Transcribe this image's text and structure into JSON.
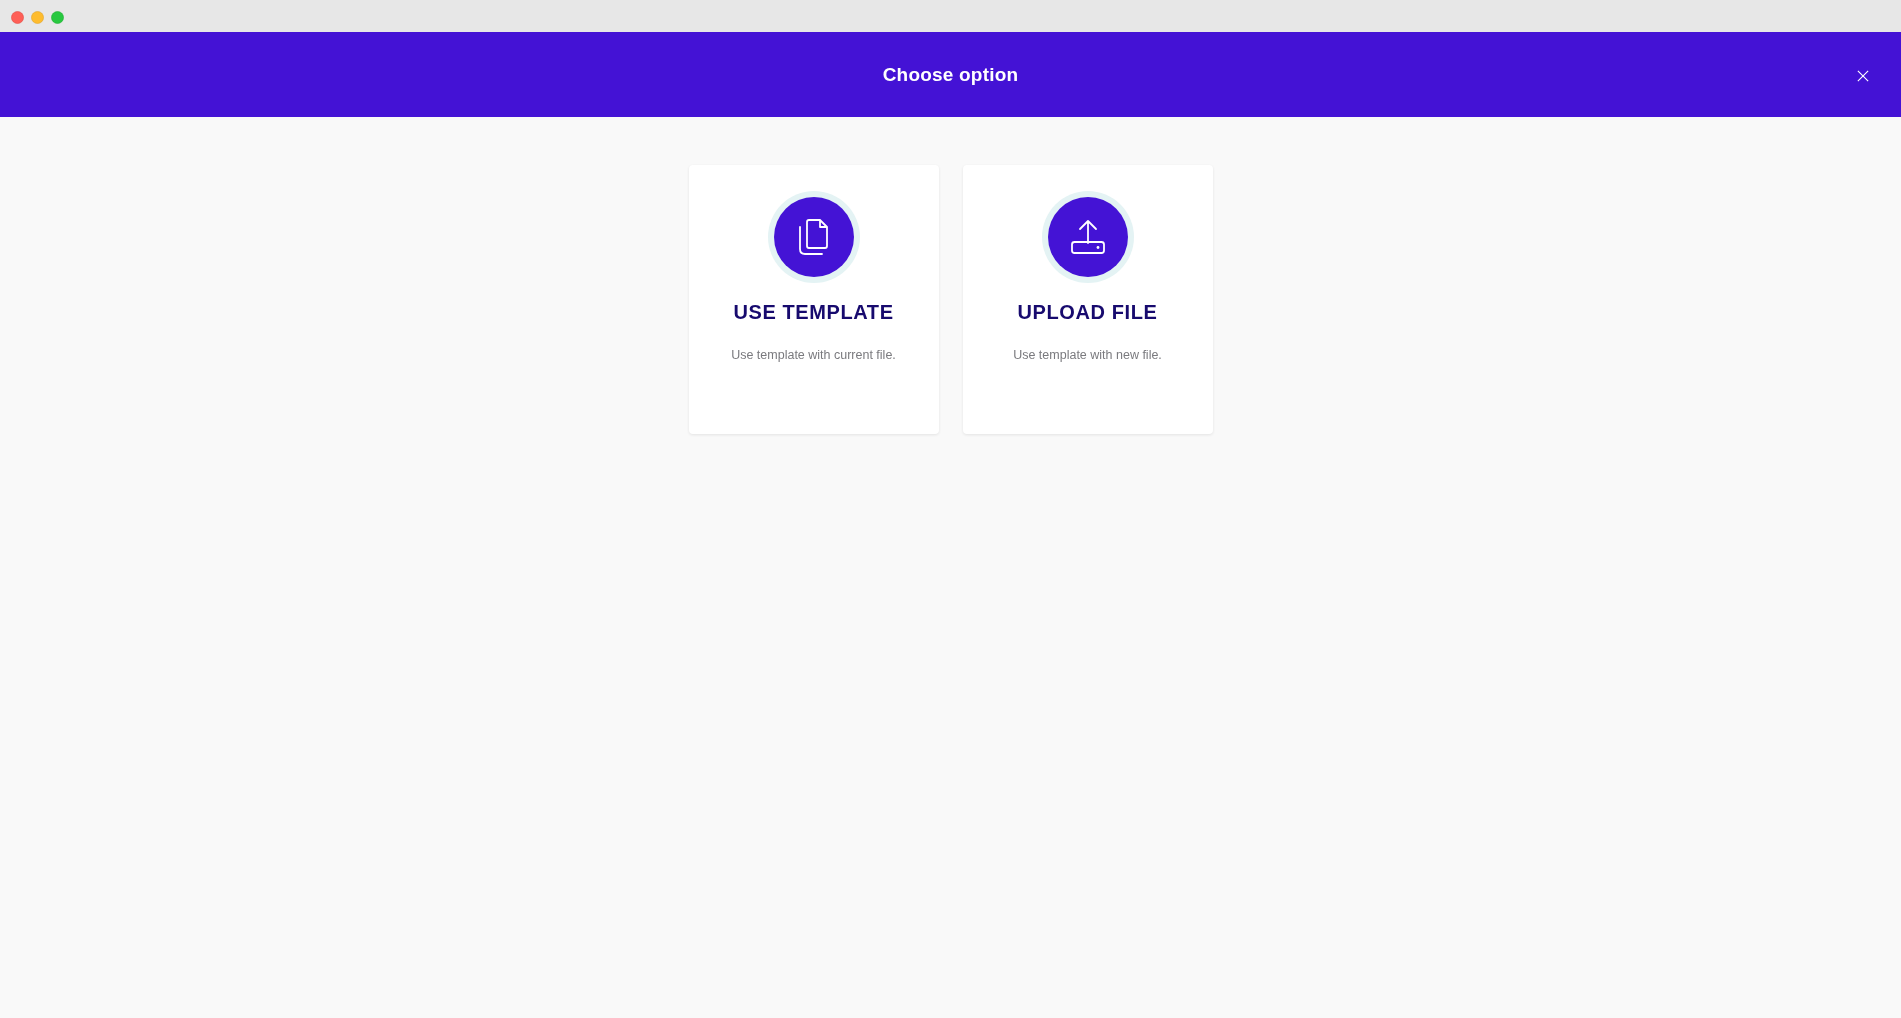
{
  "dialog": {
    "title": "Choose option"
  },
  "options": [
    {
      "kind": "template",
      "title": "USE TEMPLATE",
      "description": "Use template with current file."
    },
    {
      "kind": "upload",
      "title": "UPLOAD FILE",
      "description": "Use template with new file."
    }
  ]
}
